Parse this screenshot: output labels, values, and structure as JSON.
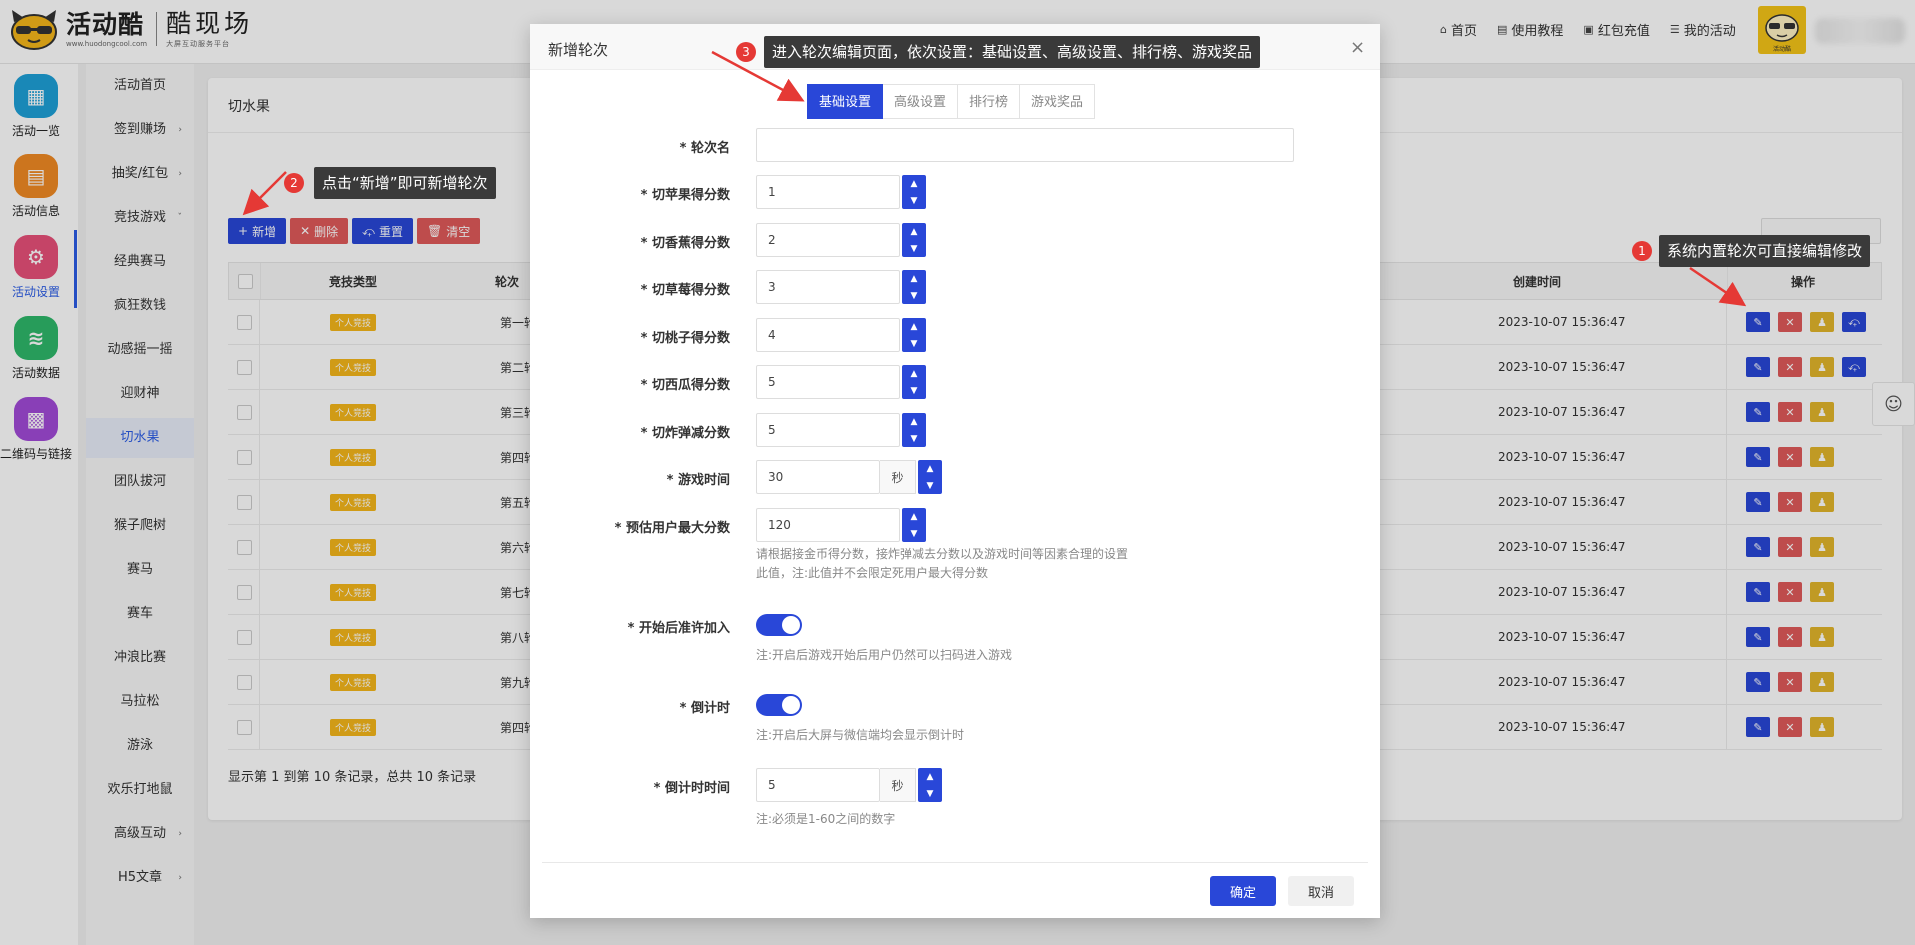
{
  "header": {
    "logo_cn": "活动酷",
    "logo_url": "www.huodongcool.com",
    "brand2": "酷现场",
    "brand2_sub": "大屏互动服务平台",
    "nav": [
      {
        "icon": "home-icon",
        "label": "首页"
      },
      {
        "icon": "book-icon",
        "label": "使用教程"
      },
      {
        "icon": "wallet-icon",
        "label": "红包充值"
      },
      {
        "icon": "list-icon",
        "label": "我的活动"
      }
    ],
    "avatar_caption": "活动酷"
  },
  "rail": [
    {
      "label": "活动一览",
      "icon": "grid-icon",
      "color": "#1ea0d8"
    },
    {
      "label": "活动信息",
      "icon": "document-icon",
      "color": "#f08a24"
    },
    {
      "label": "活动设置",
      "icon": "gear-icon",
      "color": "#e8517a"
    },
    {
      "label": "活动数据",
      "icon": "database-icon",
      "color": "#2eb86a"
    },
    {
      "label": "二维码与链接",
      "icon": "qrcode-icon",
      "color": "#a24ad8"
    }
  ],
  "submenu": [
    {
      "label": "活动首页",
      "arrow": ""
    },
    {
      "label": "签到赚场",
      "arrow": "›"
    },
    {
      "label": "抽奖/红包",
      "arrow": "›"
    },
    {
      "label": "竞技游戏",
      "arrow": "ˇ"
    },
    {
      "label": "经典赛马",
      "arrow": ""
    },
    {
      "label": "疯狂数钱",
      "arrow": ""
    },
    {
      "label": "动感摇一摇",
      "arrow": ""
    },
    {
      "label": "迎财神",
      "arrow": ""
    },
    {
      "label": "切水果",
      "arrow": ""
    },
    {
      "label": "团队拔河",
      "arrow": ""
    },
    {
      "label": "猴子爬树",
      "arrow": ""
    },
    {
      "label": "赛马",
      "arrow": ""
    },
    {
      "label": "赛车",
      "arrow": ""
    },
    {
      "label": "冲浪比赛",
      "arrow": ""
    },
    {
      "label": "马拉松",
      "arrow": ""
    },
    {
      "label": "游泳",
      "arrow": ""
    },
    {
      "label": "欢乐打地鼠",
      "arrow": ""
    },
    {
      "label": "高级互动",
      "arrow": "›"
    },
    {
      "label": "H5文章",
      "arrow": "›"
    }
  ],
  "panel": {
    "title": "切水果",
    "toolbar": [
      {
        "icon": "+",
        "label": "新增",
        "style": "blue"
      },
      {
        "icon": "✕",
        "label": "删除",
        "style": "red"
      },
      {
        "icon": "⤽",
        "label": "重置",
        "style": "blue"
      },
      {
        "icon": "🗑",
        "label": "清空",
        "style": "red"
      }
    ],
    "columns": {
      "type": "竞技类型",
      "name": "轮次",
      "created": "创建时间",
      "ops": "操作"
    },
    "rows": [
      {
        "tag": "个人竞技",
        "name": "第一轮",
        "created": "2023-10-07 15:36:47",
        "reset": true
      },
      {
        "tag": "个人竞技",
        "name": "第二轮",
        "created": "2023-10-07 15:36:47",
        "reset": true
      },
      {
        "tag": "个人竞技",
        "name": "第三轮",
        "created": "2023-10-07 15:36:47",
        "reset": false
      },
      {
        "tag": "个人竞技",
        "name": "第四轮",
        "created": "2023-10-07 15:36:47",
        "reset": false
      },
      {
        "tag": "个人竞技",
        "name": "第五轮",
        "created": "2023-10-07 15:36:47",
        "reset": false
      },
      {
        "tag": "个人竞技",
        "name": "第六轮",
        "created": "2023-10-07 15:36:47",
        "reset": false
      },
      {
        "tag": "个人竞技",
        "name": "第七轮",
        "created": "2023-10-07 15:36:47",
        "reset": false
      },
      {
        "tag": "个人竞技",
        "name": "第八轮",
        "created": "2023-10-07 15:36:47",
        "reset": false
      },
      {
        "tag": "个人竞技",
        "name": "第九轮",
        "created": "2023-10-07 15:36:47",
        "reset": false
      },
      {
        "tag": "个人竞技",
        "name": "第四轮",
        "created": "2023-10-07 15:36:47",
        "reset": false
      }
    ],
    "footer": "显示第 1 到第 10 条记录，总共 10 条记录"
  },
  "modal": {
    "title": "新增轮次",
    "close": "×",
    "tabs": [
      "基础设置",
      "高级设置",
      "排行榜",
      "游戏奖品"
    ],
    "fields": [
      {
        "label": "* 轮次名",
        "value": ""
      },
      {
        "label": "* 切苹果得分数",
        "value": "1"
      },
      {
        "label": "* 切香蕉得分数",
        "value": "2"
      },
      {
        "label": "* 切草莓得分数",
        "value": "3"
      },
      {
        "label": "* 切桃子得分数",
        "value": "4"
      },
      {
        "label": "* 切西瓜得分数",
        "value": "5"
      },
      {
        "label": "* 切炸弹减分数",
        "value": "5"
      }
    ],
    "game_time": {
      "label": "* 游戏时间",
      "value": "30",
      "unit": "秒"
    },
    "max_score": {
      "label": "* 预估用户最大分数",
      "value": "120",
      "hint1": "请根据接金币得分数，接炸弹减去分数以及游戏时间等因素合理的设置",
      "hint2": "此值，注:此值并不会限定死用户最大得分数"
    },
    "allow_join": {
      "label": "* 开始后准许加入",
      "on": true,
      "hint": "注:开启后游戏开始后用户仍然可以扫码进入游戏"
    },
    "countdown": {
      "label": "* 倒计时",
      "on": true,
      "hint": "注:开启后大屏与微信端均会显示倒计时"
    },
    "countdown_time": {
      "label": "* 倒计时时间",
      "value": "5",
      "unit": "秒",
      "hint": "注:必须是1-60之间的数字"
    },
    "ok": "确定",
    "cancel": "取消"
  },
  "annotations": [
    {
      "num": "1",
      "text": "系统内置轮次可直接编辑修改"
    },
    {
      "num": "2",
      "text": "点击“新增”即可新增轮次"
    },
    {
      "num": "3",
      "text": "进入轮次编辑页面，依次设置：基础设置、高级设置、排行榜、游戏奖品"
    }
  ]
}
